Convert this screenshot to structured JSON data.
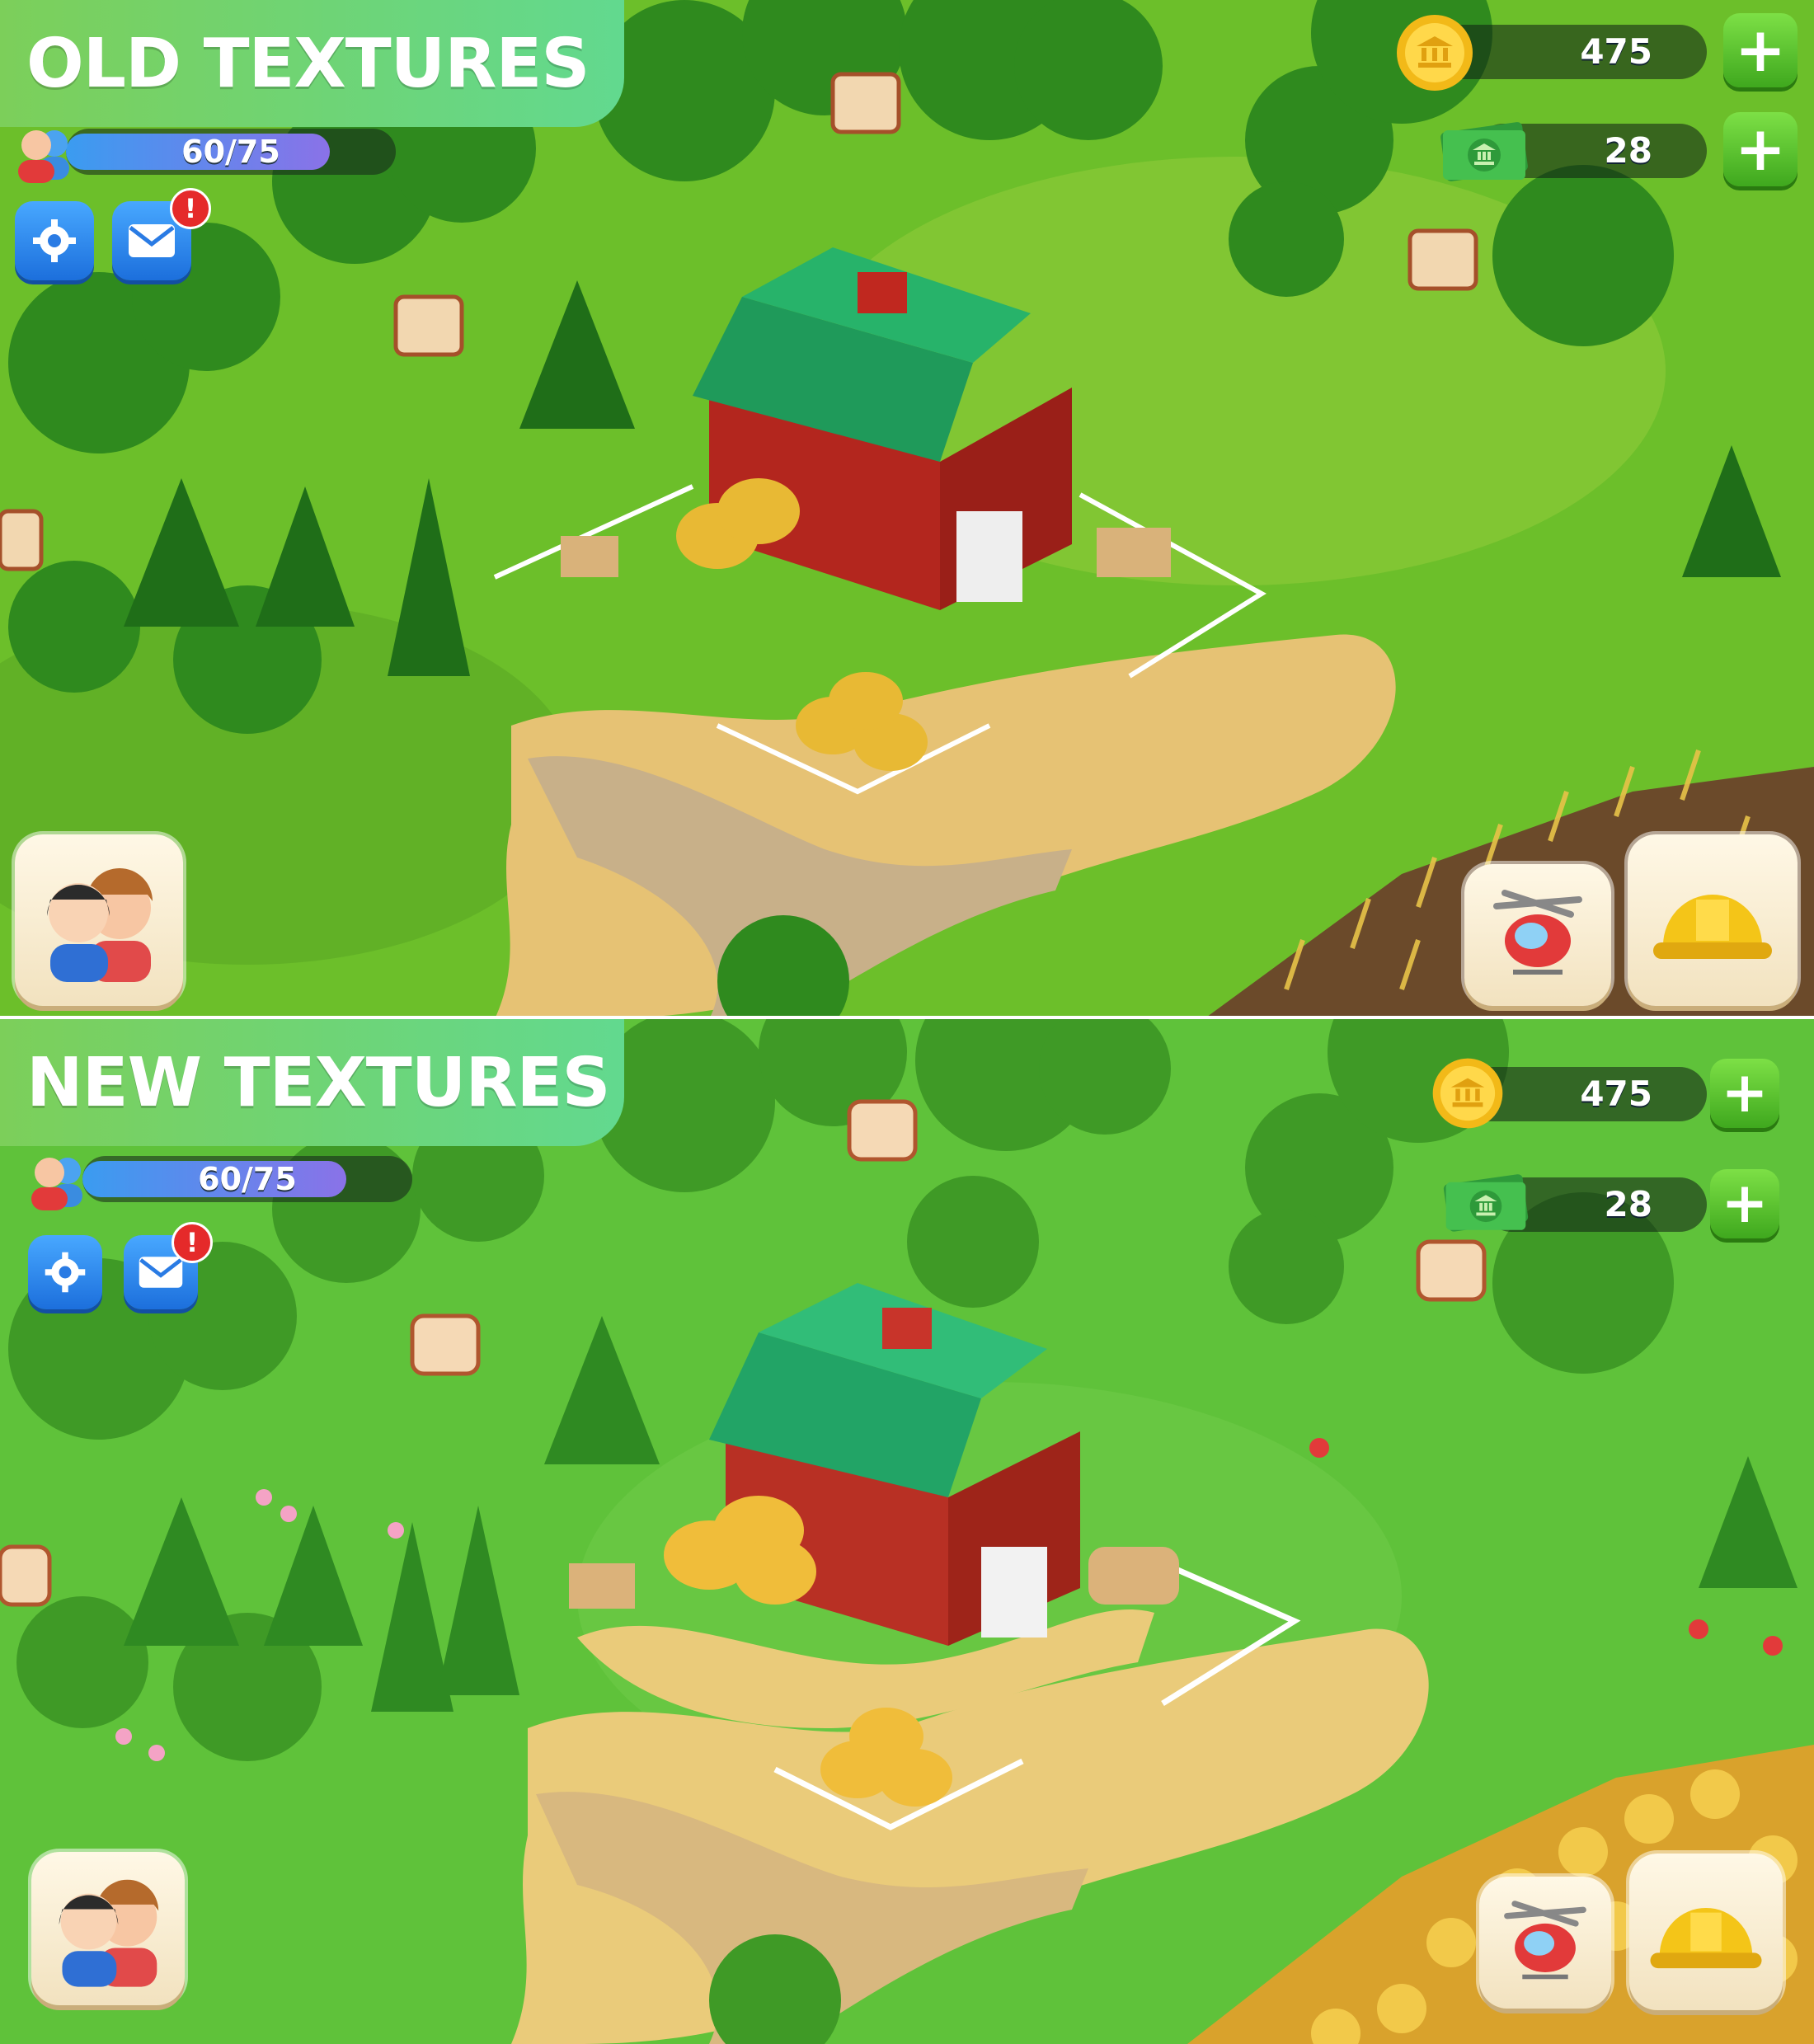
{
  "comparison": {
    "top_label": "OLD TEXTURES",
    "bottom_label": "NEW TEXTURES"
  },
  "old_panel": {
    "xp": {
      "text": "60/75",
      "progress": 0.8
    },
    "coins": {
      "value": "475",
      "icon": "coin-icon"
    },
    "cash": {
      "value": "28",
      "icon": "cash-icon"
    },
    "buttons": {
      "settings": "gear-icon",
      "mail": "mail-icon",
      "mail_alert": "!",
      "friends": "friends-avatar-icon",
      "helicopter": "helicopter-icon",
      "build": "hard-hat-icon"
    }
  },
  "new_panel": {
    "xp": {
      "text": "60/75",
      "progress": 0.8
    },
    "coins": {
      "value": "475",
      "icon": "coin-icon"
    },
    "cash": {
      "value": "28",
      "icon": "cash-icon"
    },
    "buttons": {
      "settings": "gear-icon",
      "mail": "mail-icon",
      "mail_alert": "!",
      "friends": "friends-avatar-icon",
      "helicopter": "helicopter-icon",
      "build": "hard-hat-icon"
    }
  },
  "colors": {
    "grass_old": "#6cbf2a",
    "grass_new": "#5fc23a",
    "barn_roof": "#1f9a5a",
    "barn_wall": "#b3261e",
    "banner_start": "#7ccf5a",
    "banner_end": "#62d98f",
    "plus_green": "#4cbb22",
    "ui_blue": "#2f86ea"
  }
}
